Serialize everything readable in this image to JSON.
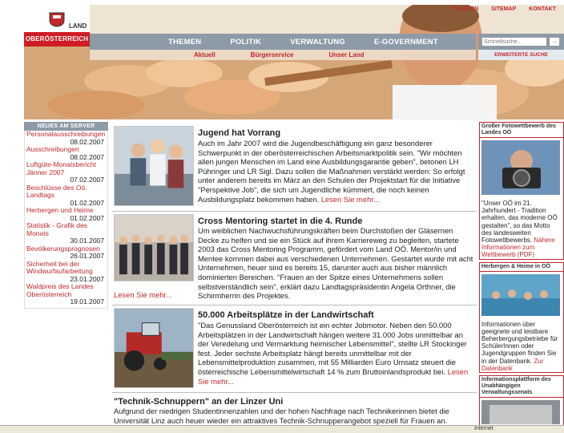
{
  "logo": {
    "land_text": "LAND",
    "region_text": "OBERÖSTERREICH"
  },
  "toplinks": [
    "TELEFON",
    "SITEMAP",
    "KONTAKT"
  ],
  "nav": [
    "THEMEN",
    "POLITIK",
    "VERWALTUNG",
    "E-GOVERNMENT"
  ],
  "subnav": [
    "Aktuell",
    "Bürgerservice",
    "Unser Land"
  ],
  "search": {
    "placeholder": "Schnellsuche...",
    "go": "→",
    "advanced": "ERWEITERTE SUCHE"
  },
  "left": {
    "heading": "NEUES AM SERVER",
    "items": [
      {
        "title": "Personalausschreibungen",
        "date": "08.02.2007"
      },
      {
        "title": "Ausschreibungen",
        "date": "08.02.2007"
      },
      {
        "title": "Luftgüte-Monatsbericht Jänner 2007",
        "date": "07.02.2007"
      },
      {
        "title": "Beschlüsse des Oö. Landtags",
        "date": "01.02.2007"
      },
      {
        "title": "Herbergen und Heime",
        "date": "01.02.2007"
      },
      {
        "title": "Statistik - Grafik des Monats",
        "date": "30.01.2007"
      },
      {
        "title": "Bevölkerungsprognosen",
        "date": "26.01.2007"
      },
      {
        "title": "Sicherheit bei der Windwurfaufarbeitung",
        "date": "23.01.2007"
      },
      {
        "title": "Waldpreis des Landes Oberösterreich",
        "date": "19.01.2007"
      }
    ]
  },
  "articles": [
    {
      "title": "Jugend hat Vorrang",
      "body": "Auch im Jahr 2007 wird die Jugendbeschäftigung ein ganz besonderer Schwerpunkt in der oberösterreichischen Arbeitsmarktpolitik sein. \"Wir möchten allen jungen Menschen im Land eine Ausbildungsgarantie geben\", betonen LH Pühringer und LR Sigl. Dazu sollen die Maßnahmen verstärkt werden: So erfolgt unter anderem bereits im März an den Schulen der Projektstart für die Initiative \"Perspektive Job\", die sich um Jugendliche kümmert, die noch keinen Ausbildungsplatz bekommen haben.",
      "more": "Lesen Sie mehr..."
    },
    {
      "title": "Cross Mentoring startet in die 4. Runde",
      "body": "Um weiblichen Nachwuchsführungskräften beim Durchstoßen der Gläsernen Decke zu helfen und sie ein Stück auf ihrem Karriereweg zu begleiten, startete 2003 das Cross Mentoring Programm, gefördert vom Land OÖ. Mentor/in und Mentee kommen dabei aus verschiedenen Unternehmen. Gestartet wurde mit acht Unternehmen, heuer sind es bereits 15, darunter auch aus bisher männlich dominierten Bereichen. \"Frauen an der Spitze eines Unternehmens sollen selbstverständlich sein\", erklärt dazu Landtagspräsidentin Angela Orthner, die Schirmherrin des Projektes.",
      "more": "Lesen Sie mehr..."
    },
    {
      "title": "50.000 Arbeitsplätze in der Landwirtschaft",
      "body": "\"Das Genussland Oberösterreich ist ein echter Jobmotor. Neben den 50.000 Arbeitsplätzen in der Landwirtschaft hängen weitere 31.000 Jobs unmittelbar an der Veredelung und Vermarktung heimischer Lebensmittel\", stellte LR Stockinger fest. Jeder sechste Arbeitsplatz hängt bereits unmittelbar mit der Lebensmittelproduktion zusammen, mit 55 Milliarden Euro Umsatz steuert die österreichische Lebensmittelwirtschaft 14 % zum Bruttoinlandsprodukt bei.",
      "more": "Lesen Sie mehr..."
    },
    {
      "title": "\"Technik-Schnuppern\" an der Linzer Uni",
      "body": "Aufgrund der niedrigen Studentinnenzahlen und der hohen Nachfrage nach Technikerinnen bietet die Universität Linz auch heuer wieder ein attraktives Technik-Schnupperangebot speziell für Frauen an.",
      "more": ""
    }
  ],
  "right": [
    {
      "heading": "Großer Fotowettbewerb des Landes OÖ",
      "text": "\"Unser OÖ im 21. Jahrhundert - Tradition erhalten, das moderne OÖ gestalten\", so das Motto des landesweiten Fotowettbewerbs.",
      "link": "Nähere Informationen zum Wettbewerb (PDF)"
    },
    {
      "heading": "Herbergen & Heime in OÖ",
      "text": "Informationen über geeignete und leistbare Beherbergungsbetriebe für SchülerInnen oder Jugendgruppen finden Sie in der Datenbank.",
      "link": "Zur Datenbank"
    },
    {
      "heading": "Informationsplattform des Unabhängigen Verwaltungssenats",
      "text": "",
      "link": ""
    }
  ],
  "status": {
    "zone": "Internet"
  }
}
